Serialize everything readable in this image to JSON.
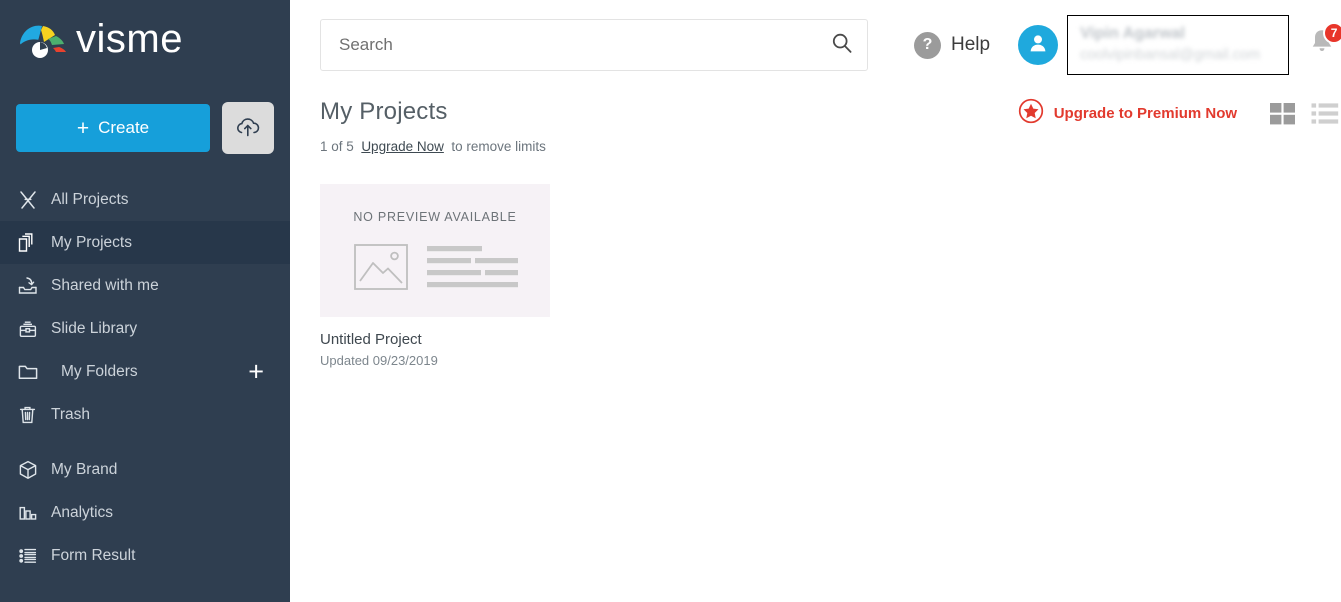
{
  "brand": {
    "name": "visme",
    "logo_colors": {
      "blue": "#21a9e1",
      "yellow": "#f5d220",
      "green": "#4caf6e",
      "red": "#e8422e"
    }
  },
  "sidebar": {
    "create_button": {
      "label": "Create",
      "plus": "+"
    },
    "upload_button_name": "upload-cloud",
    "items": [
      {
        "label": "All Projects",
        "icon": "crossed-tools-icon",
        "active": false,
        "indent": false
      },
      {
        "label": "My Projects",
        "icon": "copy-pages-icon",
        "active": true,
        "indent": false
      },
      {
        "label": "Shared with me",
        "icon": "shared-inbox-icon",
        "active": false,
        "indent": false
      },
      {
        "label": "Slide Library",
        "icon": "briefcase-icon",
        "active": false,
        "indent": false
      },
      {
        "label": "My Folders",
        "icon": "folder-icon",
        "active": false,
        "indent": true,
        "add_button": "+"
      },
      {
        "label": "Trash",
        "icon": "trash-icon",
        "active": false,
        "indent": false
      },
      {
        "label": "My Brand",
        "icon": "cube-icon",
        "active": false,
        "indent": false
      },
      {
        "label": "Analytics",
        "icon": "bar-chart-icon",
        "active": false,
        "indent": false
      },
      {
        "label": "Form Result",
        "icon": "list-results-icon",
        "active": false,
        "indent": false
      }
    ]
  },
  "header": {
    "search": {
      "value": "",
      "placeholder": "Search"
    },
    "help_label": "Help",
    "help_badge": "?",
    "user": {
      "name": "Vipin Agarwal",
      "email": "coolvipinbansal@gmail.com"
    },
    "notifications": {
      "count": "7",
      "color": "#e8352a"
    }
  },
  "content": {
    "page_title": "My Projects",
    "limit": {
      "count": "1 of 5",
      "upgrade_link": "Upgrade Now",
      "suffix": "to remove limits"
    },
    "premium": {
      "label": "Upgrade to Premium Now",
      "color": "#e23a2e"
    },
    "view": {
      "grid_label": "grid-view",
      "list_label": "list-view",
      "active": "grid"
    },
    "projects": [
      {
        "thumb_caption": "NO PREVIEW AVAILABLE",
        "name": "Untitled Project",
        "updated": "Updated 09/23/2019"
      }
    ]
  }
}
